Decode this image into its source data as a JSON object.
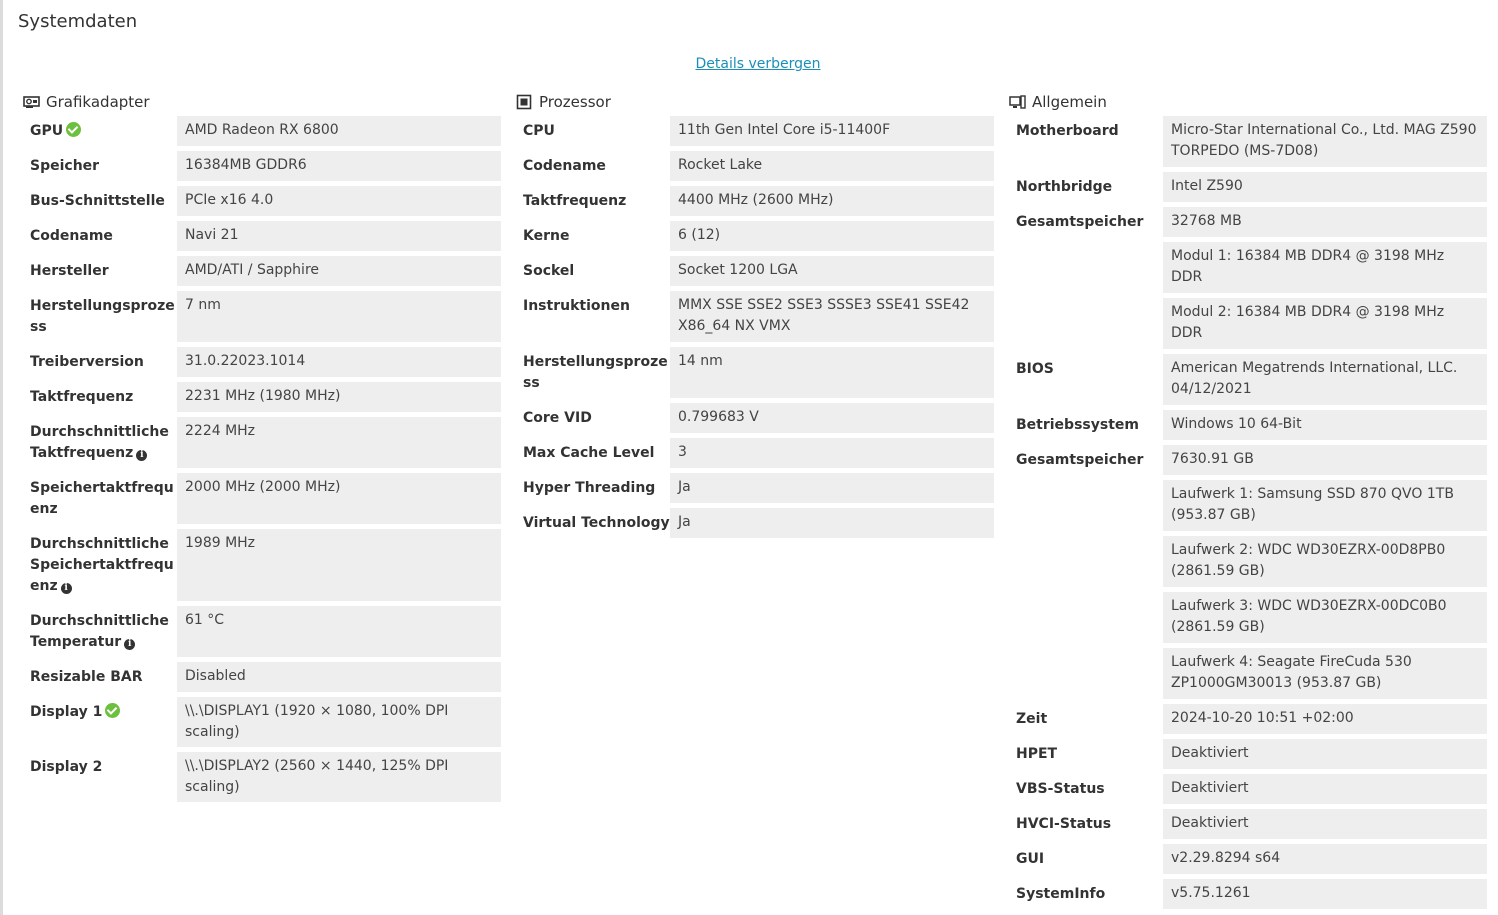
{
  "page_title": "Systemdaten",
  "toggle_label": "Details verbergen",
  "gpu": {
    "heading": "Grafikadapter",
    "rows": [
      {
        "label": "GPU",
        "value": "AMD Radeon RX 6800"
      },
      {
        "label": "Speicher",
        "value": "16384MB GDDR6"
      },
      {
        "label": "Bus-Schnittstelle",
        "value": "PCIe x16 4.0"
      },
      {
        "label": "Codename",
        "value": "Navi 21"
      },
      {
        "label": "Hersteller",
        "value": "AMD/ATI / Sapphire"
      },
      {
        "label": "Herstellungsproze ss",
        "value": "7 nm"
      },
      {
        "label": "Treiberversion",
        "value": "31.0.22023.1014"
      },
      {
        "label": "Taktfrequenz",
        "value": "2231 MHz (1980 MHz)"
      },
      {
        "label": "Durchschnittliche Taktfrequenz",
        "value": "2224 MHz"
      },
      {
        "label": "Speichertaktfrequ enz",
        "value": "2000 MHz (2000 MHz)"
      },
      {
        "label": "Durchschnittliche Speichertaktfrequ enz",
        "value": "1989 MHz"
      },
      {
        "label": "Durchschnittliche Temperatur",
        "value": "61 °C"
      },
      {
        "label": "Resizable BAR",
        "value": "Disabled"
      },
      {
        "label": "Display 1",
        "value": "\\\\.\\DISPLAY1 (1920 × 1080, 100% DPI scaling)"
      },
      {
        "label": "Display 2",
        "value": "\\\\.\\DISPLAY2 (2560 × 1440, 125% DPI scaling)"
      }
    ]
  },
  "cpu": {
    "heading": "Prozessor",
    "rows": [
      {
        "label": "CPU",
        "value": "11th Gen Intel Core i5-11400F"
      },
      {
        "label": "Codename",
        "value": "Rocket Lake"
      },
      {
        "label": "Taktfrequenz",
        "value": "4400 MHz (2600 MHz)"
      },
      {
        "label": "Kerne",
        "value": "6 (12)"
      },
      {
        "label": "Sockel",
        "value": "Socket 1200 LGA"
      },
      {
        "label": "Instruktionen",
        "value": "MMX SSE SSE2 SSE3 SSSE3 SSE41 SSE42 X86_64 NX VMX"
      },
      {
        "label": "Herstellungsproze ss",
        "value": "14 nm"
      },
      {
        "label": "Core VID",
        "value": "0.799683 V"
      },
      {
        "label": "Max Cache Level",
        "value": "3"
      },
      {
        "label": "Hyper Threading",
        "value": "Ja"
      },
      {
        "label": "Virtual Technology",
        "value": "Ja"
      }
    ]
  },
  "general": {
    "heading": "Allgemein",
    "rows": [
      {
        "label": "Motherboard",
        "value": "Micro-Star International Co., Ltd. MAG Z590 TORPEDO (MS-7D08)"
      },
      {
        "label": "Northbridge",
        "value": "Intel Z590"
      },
      {
        "label": "Gesamtspeicher",
        "value": "32768 MB"
      },
      {
        "label": "",
        "value": "Modul 1: 16384 MB DDR4 @ 3198 MHz DDR"
      },
      {
        "label": "",
        "value": "Modul 2: 16384 MB DDR4 @ 3198 MHz DDR"
      },
      {
        "label": "BIOS",
        "value": "American Megatrends International, LLC. 04/12/2021"
      },
      {
        "label": "Betriebssystem",
        "value": "Windows 10 64-Bit"
      },
      {
        "label": "Gesamtspeicher",
        "value": "7630.91 GB"
      },
      {
        "label": "",
        "value": "Laufwerk 1: Samsung SSD 870 QVO 1TB (953.87 GB)"
      },
      {
        "label": "",
        "value": "Laufwerk 2: WDC WD30EZRX-00D8PB0 (2861.59 GB)"
      },
      {
        "label": "",
        "value": "Laufwerk 3: WDC WD30EZRX-00DC0B0 (2861.59 GB)"
      },
      {
        "label": "",
        "value": "Laufwerk 4: Seagate FireCuda 530 ZP1000GM30013 (953.87 GB)"
      },
      {
        "label": "Zeit",
        "value": "2024-10-20 10:51 +02:00"
      },
      {
        "label": "HPET",
        "value": "Deaktiviert"
      },
      {
        "label": "VBS-Status",
        "value": "Deaktiviert"
      },
      {
        "label": "HVCI-Status",
        "value": "Deaktiviert"
      },
      {
        "label": "GUI",
        "value": "v2.29.8294 s64"
      },
      {
        "label": "SystemInfo",
        "value": "v5.75.1261"
      }
    ]
  }
}
